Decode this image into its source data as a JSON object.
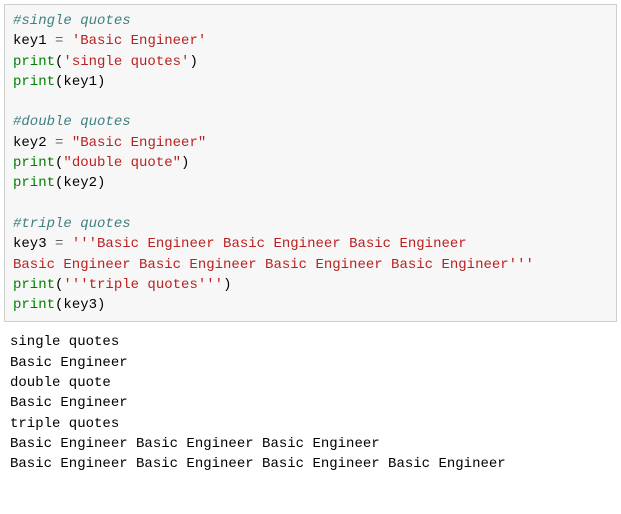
{
  "code": {
    "l01_comment": "#single quotes",
    "l02_name": "key1",
    "l02_op": " = ",
    "l02_str": "'Basic Engineer'",
    "l03_bi": "print",
    "l03_open": "(",
    "l03_str": "'single quotes'",
    "l03_close": ")",
    "l04_bi": "print",
    "l04_open": "(",
    "l04_arg": "key1",
    "l04_close": ")",
    "l05_blank": "",
    "l06_comment": "#double quotes",
    "l07_name": "key2",
    "l07_op": " = ",
    "l07_str": "\"Basic Engineer\"",
    "l08_bi": "print",
    "l08_open": "(",
    "l08_str": "\"double quote\"",
    "l08_close": ")",
    "l09_bi": "print",
    "l09_open": "(",
    "l09_arg": "key2",
    "l09_close": ")",
    "l10_blank": "",
    "l11_comment": "#triple quotes",
    "l12_name": "key3",
    "l12_op": " = ",
    "l12_str1": "'''Basic Engineer Basic Engineer Basic Engineer",
    "l13_str2": "Basic Engineer Basic Engineer Basic Engineer Basic Engineer'''",
    "l14_bi": "print",
    "l14_open": "(",
    "l14_str": "'''triple quotes'''",
    "l14_close": ")",
    "l15_bi": "print",
    "l15_open": "(",
    "l15_arg": "key3",
    "l15_close": ")"
  },
  "output": {
    "l1": "single quotes",
    "l2": "Basic Engineer",
    "l3": "double quote",
    "l4": "Basic Engineer",
    "l5": "triple quotes",
    "l6": "Basic Engineer Basic Engineer Basic Engineer",
    "l7": "Basic Engineer Basic Engineer Basic Engineer Basic Engineer"
  }
}
